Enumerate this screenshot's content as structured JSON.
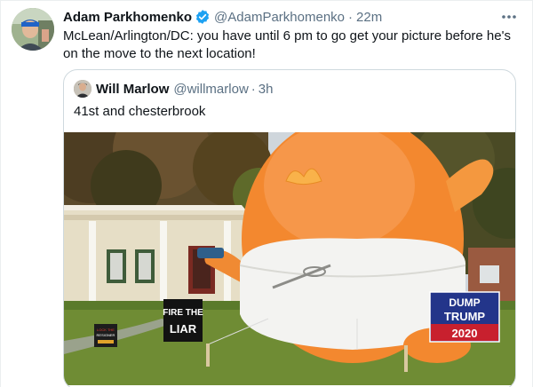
{
  "tweet": {
    "author_name": "Adam Parkhomenko",
    "author_handle": "@AdamParkhomenko",
    "separator": "·",
    "time": "22m",
    "text": "McLean/Arlington/DC: you have until 6 pm to go get your picture before he's on the move to the next location!",
    "more_icon": "more-horizontal-icon",
    "verified_icon": "verified-badge-icon"
  },
  "quote": {
    "author_name": "Will Marlow",
    "author_handle": "@willmarlow",
    "separator": "·",
    "time": "3h",
    "text": "41st and chesterbrook"
  },
  "photo": {
    "sign_left_line1": "FIRE THE",
    "sign_left_line2": "LIAR",
    "sign_right_line1": "DUMP",
    "sign_right_line2": "TRUMP",
    "sign_right_line3": "2020",
    "small_sign_line1": "LOCK THE",
    "small_sign_line2": "RESIGNER"
  },
  "colors": {
    "accent": "#1da1f2",
    "secondary_text": "#5b7083",
    "border": "#cfd9de",
    "balloon_orange": "#f3882f",
    "diaper_white": "#f3f3f1",
    "sign_blue": "#23358a",
    "sign_red": "#c8202e"
  }
}
